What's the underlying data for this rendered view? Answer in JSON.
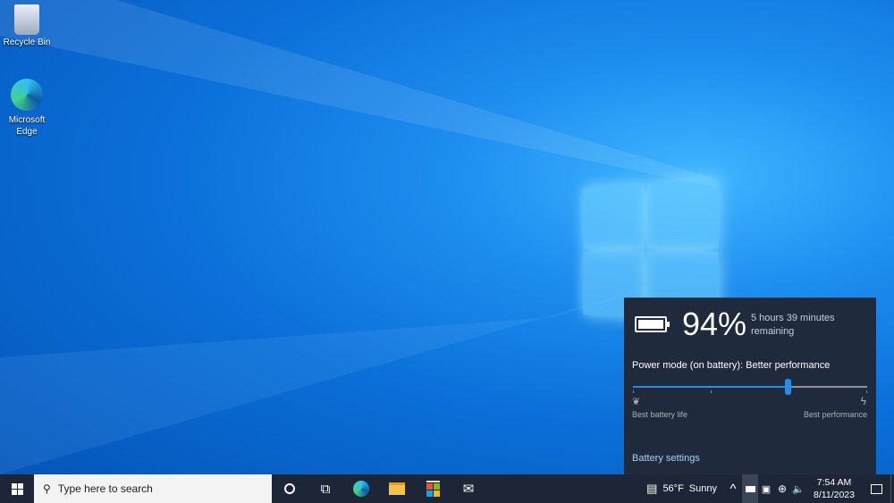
{
  "desktop": {
    "icons": [
      {
        "label": "Recycle Bin"
      },
      {
        "label": "Microsoft Edge"
      }
    ]
  },
  "battery_flyout": {
    "percent": "94%",
    "remaining_line1": "5 hours 39 minutes",
    "remaining_line2": "remaining",
    "power_mode": "Power mode (on battery): Better performance",
    "slider_value": 0.66,
    "left_label": "Best battery life",
    "right_label": "Best performance",
    "settings_link": "Battery settings"
  },
  "taskbar": {
    "search_placeholder": "Type here to search",
    "weather_temp": "56°F",
    "weather_text": "Sunny",
    "time": "7:54 AM",
    "date": "8/11/2023"
  }
}
